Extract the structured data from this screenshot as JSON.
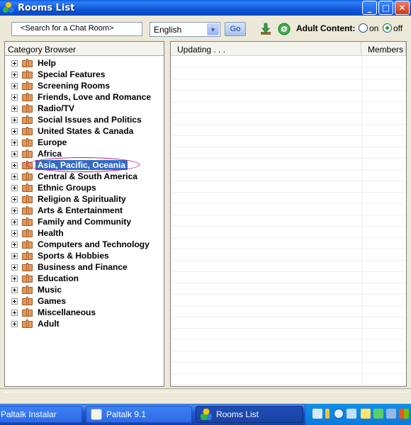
{
  "window": {
    "title": "Rooms List"
  },
  "toolbar": {
    "search_placeholder": "<Search for a Chat Room>",
    "language_selected": "English",
    "go_label": "Go",
    "adult_label": "Adult Content:",
    "adult_on_label": "on",
    "adult_off_label": "off",
    "adult_value": "off"
  },
  "category_browser": {
    "title": "Category Browser",
    "selected": "Asia, Pacific, Oceania",
    "items": [
      "Help",
      "Special Features",
      "Screening Rooms",
      "Friends, Love and Romance",
      "Radio/TV",
      "Social Issues and Politics",
      "United States & Canada",
      "Europe",
      "Africa",
      "Asia, Pacific, Oceania",
      "Central & South America",
      "Ethnic Groups",
      "Religion & Spirituality",
      "Arts & Entertainment",
      "Family and Community",
      "Health",
      "Computers and Technology",
      "Sports & Hobbies",
      "Business and Finance",
      "Education",
      "Music",
      "Games",
      "Miscellaneous",
      "Adult"
    ]
  },
  "rooms_list": {
    "columns": [
      "Updating . . .",
      "Members"
    ],
    "rows": []
  },
  "taskbar": {
    "buttons": [
      {
        "label": "Paltalk Instalar",
        "active": false
      },
      {
        "label": "Paltalk 9.1",
        "active": false
      },
      {
        "label": "Rooms List",
        "active": true
      }
    ]
  },
  "colors": {
    "selection": "#316ac5",
    "annotation_circle": "#c8137f",
    "titlebar": "#0c58d8"
  }
}
